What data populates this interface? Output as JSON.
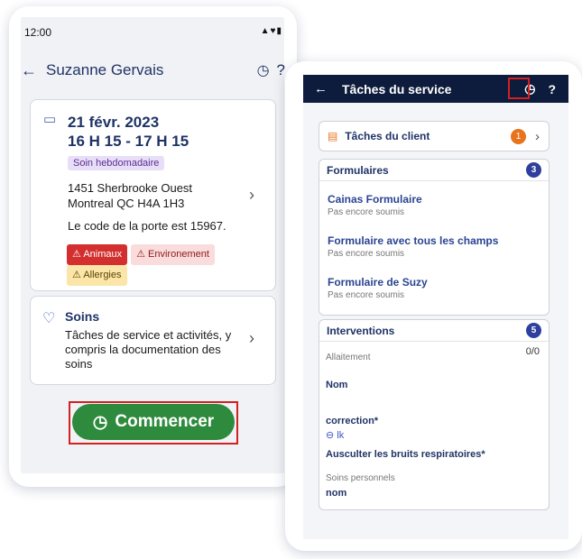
{
  "left_phone": {
    "status_time": "12:00",
    "status_icons": "▲♥▮",
    "client_name": "Suzanne Gervais",
    "appointment": {
      "date": "21 févr. 2023",
      "time": "16 H 15 - 17 H 15",
      "frequency": "Soin hebdomadaire",
      "address_line1": "1451 Sherbrooke Ouest",
      "address_line2": "Montreal QC H4A 1H3",
      "door_code": "Le code de la porte est 15967.",
      "tags": {
        "animals": "Animaux",
        "environment": "Environement",
        "allergies": "Allergies"
      }
    },
    "care": {
      "title": "Soins",
      "description": "Tâches de service et activités, y compris la documentation des soins"
    },
    "start_button": "Commencer"
  },
  "right_phone": {
    "header_title": "Tâches du service",
    "help": "?",
    "client_tasks": {
      "label": "Tâches du client",
      "count": "1"
    },
    "forms": {
      "title": "Formulaires",
      "count": "3",
      "items": [
        {
          "name": "Cainas Formulaire",
          "status": "Pas encore soumis"
        },
        {
          "name": "Formulaire avec tous les champs",
          "status": "Pas encore soumis"
        },
        {
          "name": "Formulaire de Suzy",
          "status": "Pas encore soumis"
        }
      ]
    },
    "interventions": {
      "title": "Interventions",
      "count": "5",
      "category1": "Allaitement",
      "progress": "0/0",
      "item1": "Nom",
      "item2": "correction*",
      "link": "lk",
      "item3": "Ausculter les bruits respiratoires*",
      "category2": "Soins personnels",
      "item4": "nom"
    }
  },
  "colors": {
    "navy": "#0d1b3c",
    "green": "#2e8a3c",
    "orange": "#e8731d",
    "highlight": "#d32020"
  }
}
